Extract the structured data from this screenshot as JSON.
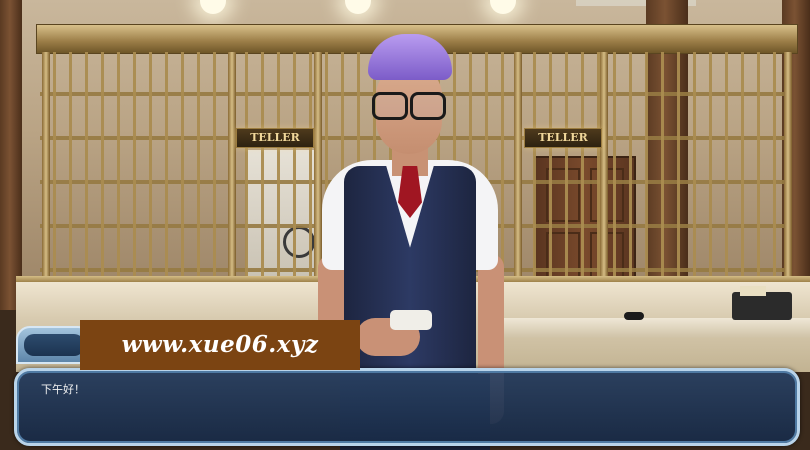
{
  "scene": {
    "signs": [
      "TELLER",
      "TELLER"
    ]
  },
  "watermark": {
    "text": "www.xue06.xyz"
  },
  "dialogue": {
    "text": "下午好！"
  },
  "colors": {
    "watermark_bg": "#7b4412",
    "dialog_border": "#b9d4ea",
    "dialog_bg": "#1e3556",
    "hair": "#9b7fe0",
    "vest": "#24305a",
    "tie": "#a01622"
  }
}
